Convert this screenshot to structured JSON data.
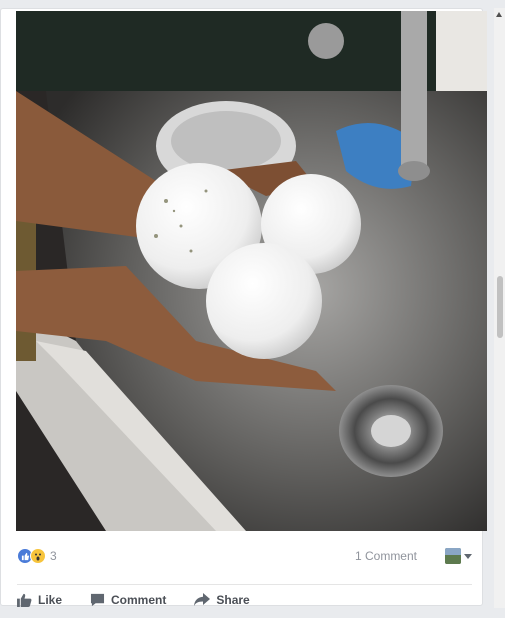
{
  "post": {
    "reaction_count": "3",
    "comment_count": "1 Comment",
    "actions": {
      "like": "Like",
      "comment": "Comment",
      "share": "Share"
    }
  },
  "icons": {
    "reactions": [
      "like-reaction-icon",
      "wow-reaction-icon"
    ],
    "like": "thumbs-up-icon",
    "comment": "speech-bubble-icon",
    "share": "share-arrow-icon",
    "viewer": "page-avatar-icon",
    "dropdown": "caret-down-icon"
  },
  "colors": {
    "like_blue": "#4a7bd8",
    "wow_yellow": "#f7c43c",
    "action_text": "#4b4f56",
    "muted_text": "#90949c"
  }
}
